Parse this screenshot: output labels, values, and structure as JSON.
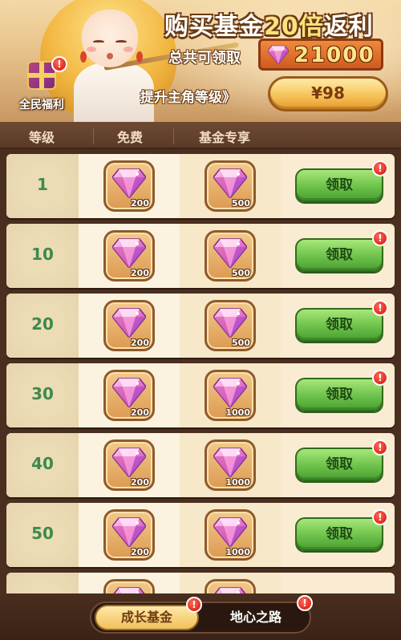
{
  "header": {
    "title_prefix": "购买基金",
    "title_multiplier": "20倍",
    "title_suffix": "返利",
    "total_label": "总共可领取",
    "total_value": "21000",
    "upgrade_link": "提升主角等级》",
    "price_button": "¥98",
    "gift_label": "全民福利",
    "gift_badge": "!"
  },
  "columns": {
    "level": "等级",
    "free": "免费",
    "fund": "基金专享"
  },
  "rows": [
    {
      "level": "1",
      "free_qty": "200",
      "fund_qty": "500",
      "claim": "领取",
      "badge": "!"
    },
    {
      "level": "10",
      "free_qty": "200",
      "fund_qty": "500",
      "claim": "领取",
      "badge": "!"
    },
    {
      "level": "20",
      "free_qty": "200",
      "fund_qty": "500",
      "claim": "领取",
      "badge": "!"
    },
    {
      "level": "30",
      "free_qty": "200",
      "fund_qty": "1000",
      "claim": "领取",
      "badge": "!"
    },
    {
      "level": "40",
      "free_qty": "200",
      "fund_qty": "1000",
      "claim": "领取",
      "badge": "!"
    },
    {
      "level": "50",
      "free_qty": "200",
      "fund_qty": "1000",
      "claim": "领取",
      "badge": "!"
    }
  ],
  "tabs": {
    "active": "成长基金",
    "inactive": "地心之路",
    "active_badge": "!",
    "inactive_badge": "!"
  },
  "colors": {
    "claim_green": "#6cc24a",
    "level_text": "#3c8a4c",
    "badge_red": "#e02a1c",
    "gem_pink": "#f07ac8"
  }
}
